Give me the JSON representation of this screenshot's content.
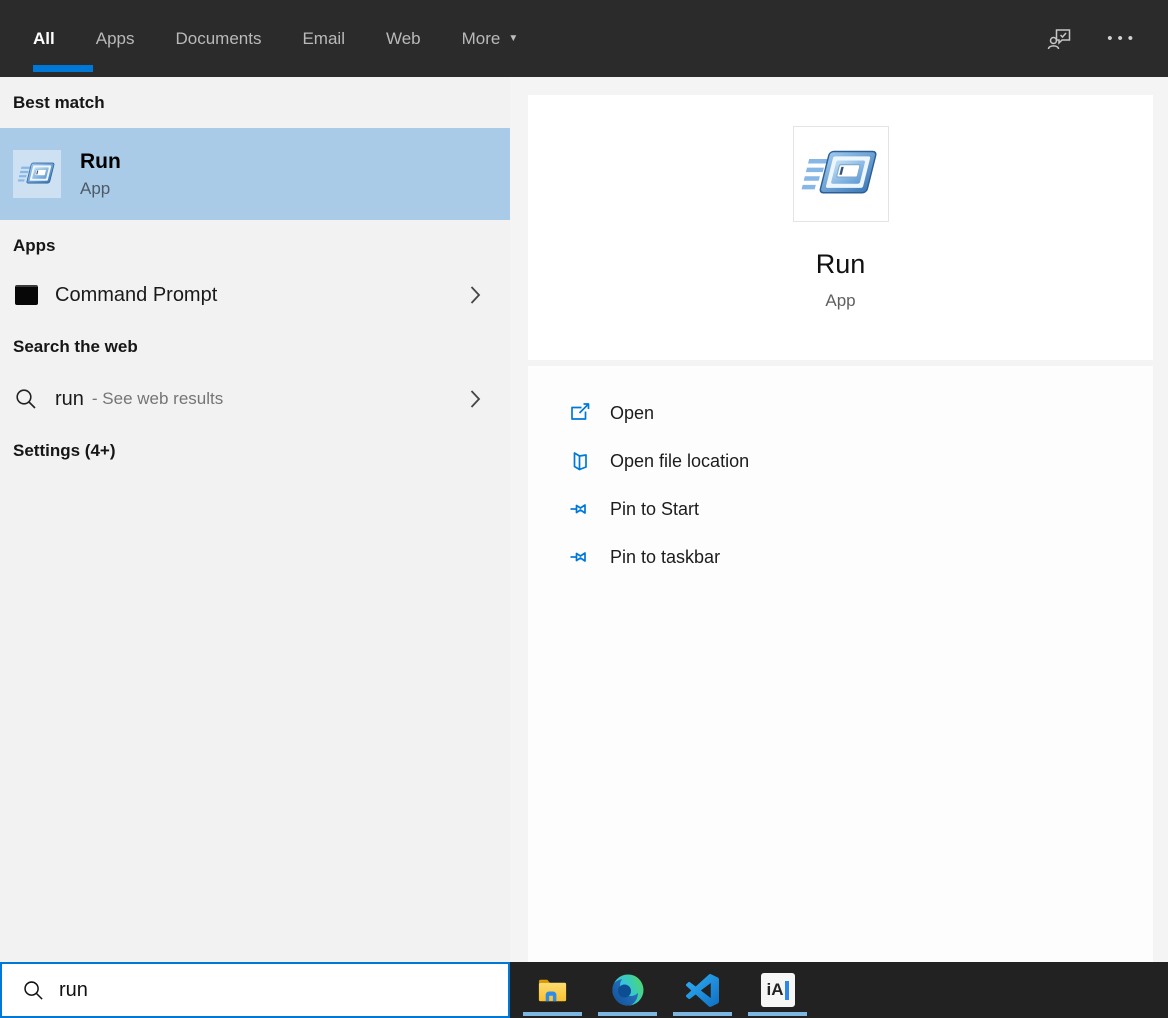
{
  "colors": {
    "accent": "#0078d7",
    "selection_blue": "#a9cbe8",
    "topbar_bg": "#2b2b2b",
    "taskbar_bg": "#222222",
    "taskbar_indicator": "#7db6e0"
  },
  "icons": {
    "caret_down": "▼",
    "ellipsis": "•••"
  },
  "header": {
    "tabs": [
      {
        "label": "All",
        "active": true
      },
      {
        "label": "Apps",
        "active": false
      },
      {
        "label": "Documents",
        "active": false
      },
      {
        "label": "Email",
        "active": false
      },
      {
        "label": "Web",
        "active": false
      },
      {
        "label": "More",
        "active": false,
        "has_caret": true
      }
    ]
  },
  "left_panel": {
    "best_match": {
      "section_title": "Best match",
      "item": {
        "name": "Run",
        "type": "App"
      }
    },
    "apps": {
      "section_title": "Apps",
      "items": [
        {
          "name": "Command Prompt"
        }
      ]
    },
    "search_web": {
      "section_title": "Search the web",
      "item": {
        "query": "run",
        "suffix": "- See web results"
      }
    },
    "settings": {
      "section_title": "Settings (4+)"
    }
  },
  "preview": {
    "name": "Run",
    "type": "App",
    "actions": [
      {
        "label": "Open"
      },
      {
        "label": "Open file location"
      },
      {
        "label": "Pin to Start"
      },
      {
        "label": "Pin to taskbar"
      }
    ]
  },
  "search_bar": {
    "value": "run"
  },
  "taskbar": {
    "items": [
      {
        "name": "file-explorer"
      },
      {
        "name": "edge"
      },
      {
        "name": "vscode"
      },
      {
        "name": "ia-writer",
        "label": "iA"
      }
    ]
  }
}
